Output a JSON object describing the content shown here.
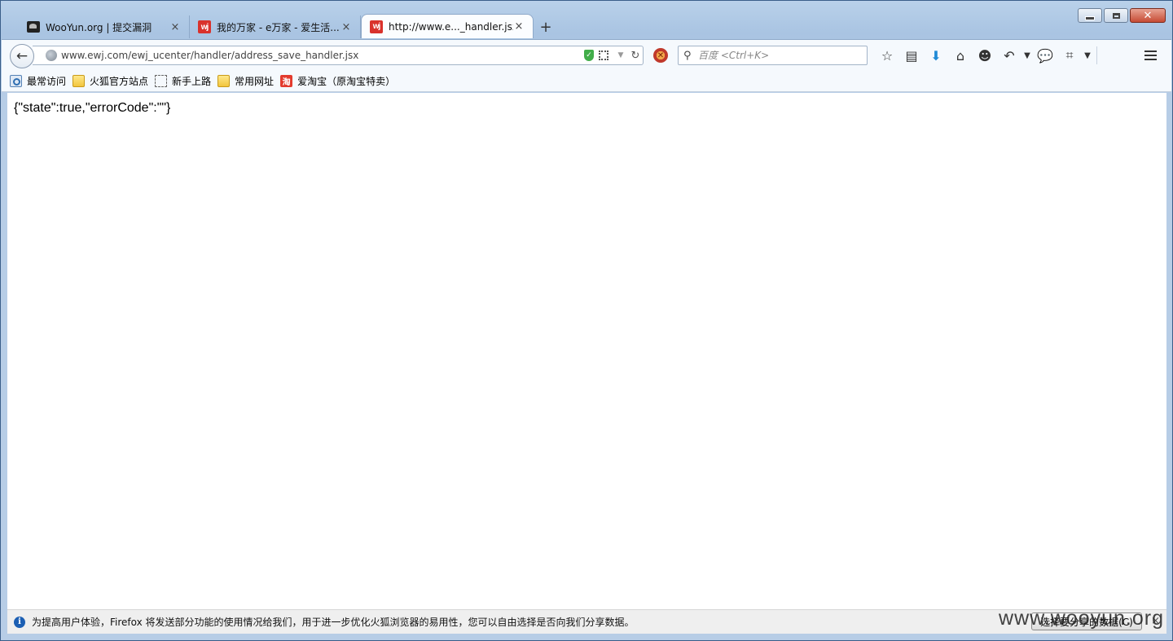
{
  "tabs": [
    {
      "title": "WooYun.org | 提交漏洞",
      "icon": "wooyun-favicon",
      "close": "×",
      "selected": false
    },
    {
      "title": "我的万家 - e万家 - 爱生活...",
      "icon": "wj-favicon",
      "close": "×",
      "selected": false
    },
    {
      "title": "http://www.e..._handler.jsx",
      "icon": "wj-favicon",
      "close": "×",
      "selected": true
    }
  ],
  "tab_favicon_text": "wj",
  "new_tab": "+",
  "navbar": {
    "url": "www.ewj.com/ewj_ucenter/handler/address_save_handler.jsx",
    "search_placeholder": "百度 <Ctrl+K>"
  },
  "bookmarks": [
    {
      "label": "最常访问",
      "icon": "most-visited-icon"
    },
    {
      "label": "火狐官方站点",
      "icon": "folder-icon"
    },
    {
      "label": "新手上路",
      "icon": "page-icon"
    },
    {
      "label": "常用网址",
      "icon": "folder-icon"
    },
    {
      "label": "爱淘宝（原淘宝特卖）",
      "icon": "taobao-icon"
    }
  ],
  "taobao_icon_text": "淘",
  "content": {
    "json_text": "{\"state\":true,\"errorCode\":\"\"}"
  },
  "notification": {
    "text": "为提高用户体验，Firefox 将发送部分功能的使用情况给我们，用于进一步优化火狐浏览器的易用性，您可以自由选择是否向我们分享数据。",
    "button": "选择要分享的数据(C)",
    "close": "×"
  },
  "watermark": "www.wooyun.org",
  "colors": {
    "frame": "#b9d1ea",
    "accent_red": "#d9322c",
    "info_blue": "#1c5fb3"
  }
}
